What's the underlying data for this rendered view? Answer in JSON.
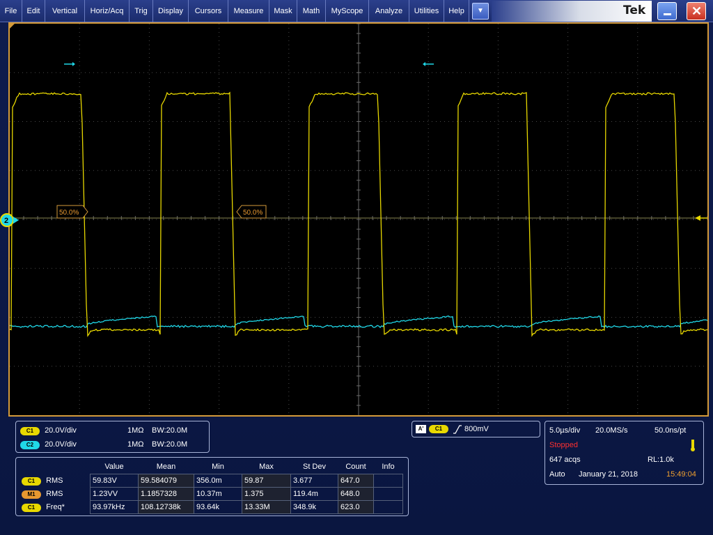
{
  "menu": {
    "items": [
      "File",
      "Edit",
      "Vertical",
      "Horiz/Acq",
      "Trig",
      "Display",
      "Cursors",
      "Measure",
      "Mask",
      "Math",
      "MyScope",
      "Analyze",
      "Utilities",
      "Help"
    ],
    "dropdown_glyph": "▼",
    "logo": "Tek",
    "minimize_label": "",
    "close_label": "✕"
  },
  "graticule": {
    "ref_labels": [
      "50.0%",
      "50.0%"
    ],
    "channel_marker": "2"
  },
  "channels": {
    "c1": {
      "badge": "C1",
      "scale": "20.0V/div",
      "coupling": "1MΩ",
      "bw": "BW:20.0M",
      "color": "#e8d800"
    },
    "c2": {
      "badge": "C2",
      "scale": "20.0V/div",
      "coupling": "1MΩ",
      "bw": "BW:20.0M",
      "color": "#20d8e8"
    }
  },
  "trigger": {
    "mode_badge": "A'",
    "source_badge": "C1",
    "slope_icon": "rising-edge-icon",
    "level": "800mV"
  },
  "acquisition": {
    "timebase": "5.0µs/div",
    "sample_rate": "20.0MS/s",
    "resolution": "50.0ns/pt",
    "state": "Stopped",
    "state_color": "#ff3030",
    "acqs": "647 acqs",
    "record_length": "RL:1.0k",
    "trigger_mode": "Auto",
    "date": "January 21, 2018",
    "time": "15:49:04",
    "time_color": "#f0a030"
  },
  "measurements": {
    "headers": [
      "Value",
      "Mean",
      "Min",
      "Max",
      "St Dev",
      "Count",
      "Info"
    ],
    "rows": [
      {
        "badge": "C1",
        "name": "RMS",
        "values": [
          "59.83V",
          "59.584079",
          "356.0m",
          "59.87",
          "3.677",
          "647.0",
          ""
        ]
      },
      {
        "badge": "M1",
        "name": "RMS",
        "values": [
          "1.23VV",
          "1.1857328",
          "10.37m",
          "1.375",
          "119.4m",
          "648.0",
          ""
        ]
      },
      {
        "badge": "C1",
        "name": "Freq*",
        "values": [
          "93.97kHz",
          "108.12738k",
          "93.64k",
          "13.33M",
          "348.9k",
          "623.0",
          ""
        ]
      }
    ]
  }
}
